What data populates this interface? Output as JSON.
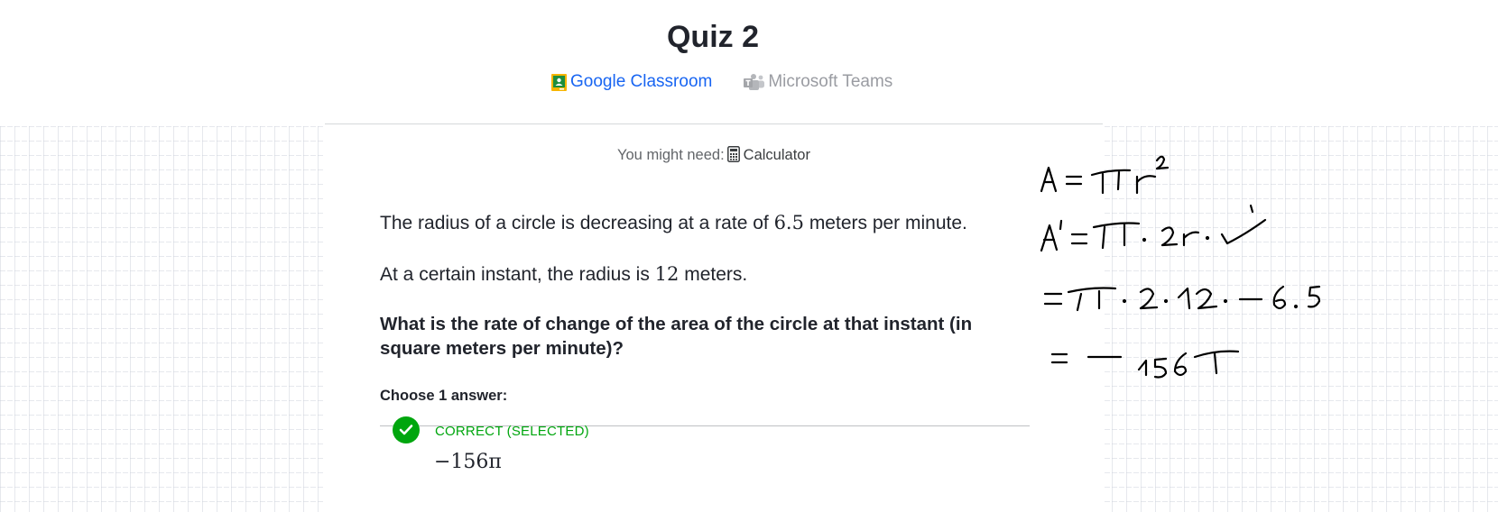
{
  "header": {
    "title": "Quiz 2",
    "share": {
      "google_classroom": "Google Classroom",
      "microsoft_teams": "Microsoft Teams"
    }
  },
  "tools": {
    "prefix": "You might need:",
    "calculator": "Calculator"
  },
  "question": {
    "line1_before": "The radius of a circle is decreasing at a rate of",
    "line1_value": "6.5",
    "line1_after": "meters per minute.",
    "line2_before": "At a certain instant, the radius is",
    "line2_value": "12",
    "line2_after": "meters.",
    "prompt": "What is the rate of change of the area of the circle at that instant (in square meters per minute)?"
  },
  "answers": {
    "choose_label": "Choose 1 answer:",
    "choice": {
      "status": "CORRECT (SELECTED)",
      "value": "−156π"
    }
  },
  "scratchpad": {
    "lines": [
      "A = πr²",
      "A′ = π · 2r · r′",
      "= π · 2 · 12 · −6.5",
      "= −156π"
    ]
  },
  "colors": {
    "accent_blue": "#1865f2",
    "correct_green": "#00a60e",
    "text": "#21242c",
    "muted": "#9a9ca2"
  }
}
